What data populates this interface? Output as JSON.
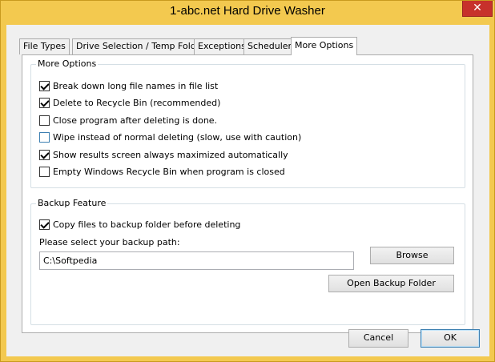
{
  "window": {
    "title": "1-abc.net Hard Drive Washer",
    "close_glyph": "✕"
  },
  "tabs": [
    {
      "label": "File Types",
      "active": false
    },
    {
      "label": "Drive Selection / Temp Folder",
      "active": false
    },
    {
      "label": "Exceptions",
      "active": false
    },
    {
      "label": "Scheduler",
      "active": false
    },
    {
      "label": "More Options",
      "active": true
    }
  ],
  "more_options": {
    "legend": "More Options",
    "items": [
      {
        "label": "Break down long file names in file list",
        "checked": true
      },
      {
        "label": "Delete to Recycle Bin (recommended)",
        "checked": true
      },
      {
        "label": "Close program after deleting is done.",
        "checked": false
      },
      {
        "label": "Wipe instead of normal deleting (slow, use with caution)",
        "checked": false
      },
      {
        "label": "Show results screen always maximized automatically",
        "checked": true
      },
      {
        "label": "Empty Windows Recycle Bin when program is closed",
        "checked": false
      }
    ]
  },
  "backup": {
    "legend": "Backup Feature",
    "copy_label": "Copy files to backup folder before deleting",
    "copy_checked": true,
    "path_label": "Please select your backup path:",
    "path_value": "C:\\Softpedia",
    "browse_label": "Browse",
    "open_folder_label": "Open Backup Folder"
  },
  "footer": {
    "cancel_label": "Cancel",
    "ok_label": "OK"
  }
}
